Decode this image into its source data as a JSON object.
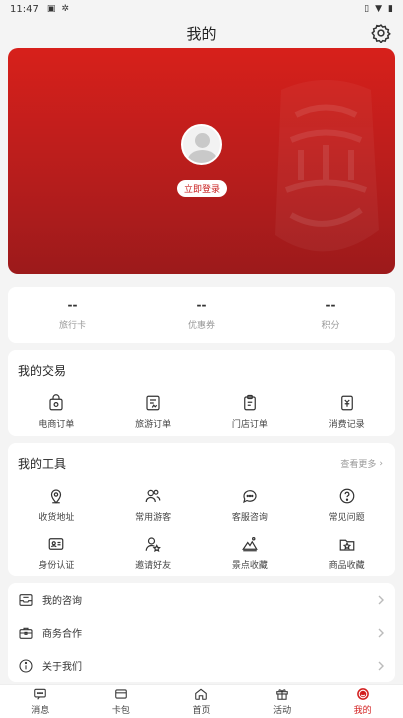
{
  "status_bar": {
    "time": "11:47",
    "icons": [
      "sim-icon",
      "bug-icon"
    ],
    "right_icons": [
      "vibrate-icon",
      "wifi-icon",
      "battery-icon"
    ]
  },
  "header": {
    "title": "我的",
    "settings_icon": "gear-icon"
  },
  "hero": {
    "login_label": "立即登录",
    "brand_color": "#c81e1e"
  },
  "stats": [
    {
      "value": "--",
      "label": "旅行卡"
    },
    {
      "value": "--",
      "label": "优惠券"
    },
    {
      "value": "--",
      "label": "积分"
    }
  ],
  "transactions": {
    "title": "我的交易",
    "items": [
      {
        "label": "电商订单",
        "icon": "order-bag-icon"
      },
      {
        "label": "旅游订单",
        "icon": "travel-order-icon"
      },
      {
        "label": "门店订单",
        "icon": "store-order-icon"
      },
      {
        "label": "消费记录",
        "icon": "consumption-record-icon"
      }
    ]
  },
  "tools": {
    "title": "我的工具",
    "more_label": "查看更多",
    "items": [
      {
        "label": "收货地址",
        "icon": "location-pin-icon"
      },
      {
        "label": "常用游客",
        "icon": "users-icon"
      },
      {
        "label": "客服咨询",
        "icon": "chat-bubble-icon"
      },
      {
        "label": "常见问题",
        "icon": "question-icon"
      },
      {
        "label": "身份认证",
        "icon": "id-card-icon"
      },
      {
        "label": "邀请好友",
        "icon": "invite-friend-icon"
      },
      {
        "label": "景点收藏",
        "icon": "mountain-icon"
      },
      {
        "label": "商品收藏",
        "icon": "product-favorite-icon"
      }
    ]
  },
  "menu": [
    {
      "label": "我的咨询",
      "icon": "inbox-icon"
    },
    {
      "label": "商务合作",
      "icon": "briefcase-icon"
    },
    {
      "label": "关于我们",
      "icon": "info-icon"
    }
  ],
  "tabbar": [
    {
      "label": "消息",
      "icon": "message-icon",
      "active": false
    },
    {
      "label": "卡包",
      "icon": "card-wallet-icon",
      "active": false
    },
    {
      "label": "首页",
      "icon": "home-icon",
      "active": false
    },
    {
      "label": "活动",
      "icon": "gift-icon",
      "active": false
    },
    {
      "label": "我的",
      "icon": "smile-icon",
      "active": true
    }
  ]
}
